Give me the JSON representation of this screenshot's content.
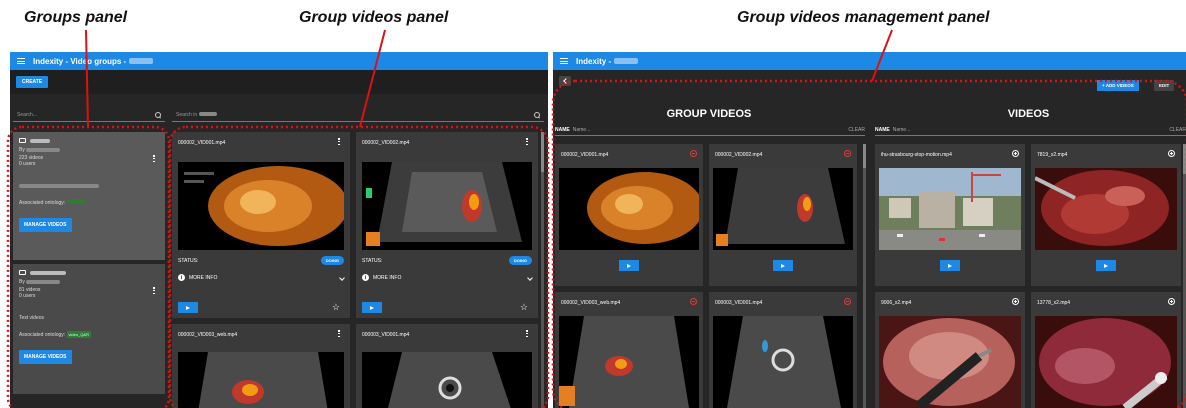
{
  "annotations": {
    "groups_panel": "Groups panel",
    "group_videos_panel": "Group videos panel",
    "management_panel": "Group videos management panel"
  },
  "left_window": {
    "title": "Indexity - Video groups -",
    "create_label": "CREATE",
    "groups_search_placeholder": "Search...",
    "videos_search_placeholder": "Search in",
    "groups": [
      {
        "videos": "223 videos",
        "users": "0 users",
        "ontology_label": "Associated ontology:",
        "manage_label": "MANAGE VIDEOS"
      },
      {
        "videos": "81 videos",
        "users": "0 users",
        "description": "Test videos",
        "ontology_label": "Associated ontology:",
        "ontology_tag": "video_Q&R",
        "manage_label": "MANAGE VIDEOS"
      }
    ],
    "videos": [
      {
        "name": "000002_VID001.mp4",
        "status_label": "STATUS:",
        "status": "DOING",
        "info": "MORE INFO"
      },
      {
        "name": "000002_VID002.mp4",
        "status_label": "STATUS:",
        "status": "DOING",
        "info": "MORE INFO"
      },
      {
        "name": "000002_VID003_web.mp4"
      },
      {
        "name": "000003_VID001.mp4"
      }
    ]
  },
  "right_window": {
    "title": "Indexity -",
    "add_videos_label": "+ ADD VIDEOS",
    "edit_label": "EDIT",
    "group_videos_title": "GROUP VIDEOS",
    "videos_title": "VIDEOS",
    "name_label": "NAME",
    "name_placeholder": "Name...",
    "clear_label": "CLEAR",
    "group_videos": [
      {
        "name": "000002_VID001.mp4"
      },
      {
        "name": "000002_VID002.mp4"
      },
      {
        "name": "000002_VID003_web.mp4"
      },
      {
        "name": "000003_VID001.mp4"
      }
    ],
    "videos": [
      {
        "name": "ihu-strasbourg-stop-motion.mp4"
      },
      {
        "name": "7819_x2.mp4"
      },
      {
        "name": "9006_x2.mp4"
      },
      {
        "name": "13778_x2.mp4"
      }
    ]
  },
  "colors": {
    "appbar": "#1e88e5",
    "background": "#262626",
    "card": "#3a3a3a",
    "remove": "#e53935"
  },
  "icons": [
    "menu-icon",
    "search-icon",
    "folder-icon",
    "kebab-icon",
    "info-icon",
    "chevron-down-icon",
    "play-icon",
    "star-icon",
    "remove-icon",
    "add-icon",
    "back-icon"
  ]
}
